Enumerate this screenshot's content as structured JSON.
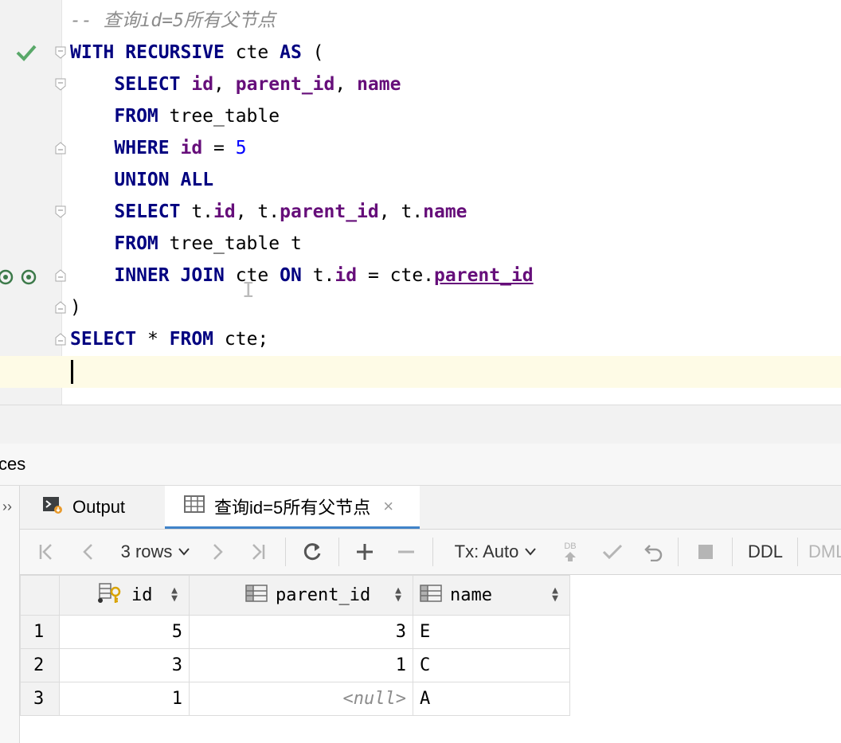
{
  "editor": {
    "lines": [
      {
        "comment": "-- 查询id=5所有父节点"
      },
      {
        "tokens": [
          [
            "kw",
            "WITH"
          ],
          [
            "t",
            " "
          ],
          [
            "kw",
            "RECURSIVE"
          ],
          [
            "t",
            " cte "
          ],
          [
            "kw",
            "AS"
          ],
          [
            "t",
            " ("
          ]
        ]
      },
      {
        "tokens": [
          [
            "t",
            "    "
          ],
          [
            "kw",
            "SELECT"
          ],
          [
            "t",
            " "
          ],
          [
            "col",
            "id"
          ],
          [
            "t",
            ", "
          ],
          [
            "col",
            "parent_id"
          ],
          [
            "t",
            ", "
          ],
          [
            "col",
            "name"
          ]
        ]
      },
      {
        "tokens": [
          [
            "t",
            "    "
          ],
          [
            "kw",
            "FROM"
          ],
          [
            "t",
            " tree_table"
          ]
        ]
      },
      {
        "tokens": [
          [
            "t",
            "    "
          ],
          [
            "kw",
            "WHERE"
          ],
          [
            "t",
            " "
          ],
          [
            "col",
            "id"
          ],
          [
            "t",
            " = "
          ],
          [
            "num",
            "5"
          ]
        ]
      },
      {
        "tokens": [
          [
            "t",
            "    "
          ],
          [
            "kw",
            "UNION"
          ],
          [
            "t",
            " "
          ],
          [
            "kw",
            "ALL"
          ]
        ]
      },
      {
        "tokens": [
          [
            "t",
            "    "
          ],
          [
            "kw",
            "SELECT"
          ],
          [
            "t",
            " t."
          ],
          [
            "col",
            "id"
          ],
          [
            "t",
            ", t."
          ],
          [
            "col",
            "parent_id"
          ],
          [
            "t",
            ", t."
          ],
          [
            "col",
            "name"
          ]
        ]
      },
      {
        "tokens": [
          [
            "t",
            "    "
          ],
          [
            "kw",
            "FROM"
          ],
          [
            "t",
            " tree_table t"
          ]
        ]
      },
      {
        "tokens": [
          [
            "t",
            "    "
          ],
          [
            "kw",
            "INNER"
          ],
          [
            "t",
            " "
          ],
          [
            "kw",
            "JOIN"
          ],
          [
            "t",
            " cte "
          ],
          [
            "kw",
            "ON"
          ],
          [
            "t",
            " t."
          ],
          [
            "col",
            "id"
          ],
          [
            "t",
            " = cte."
          ],
          [
            "colul",
            "parent_id"
          ]
        ]
      },
      {
        "tokens": [
          [
            "t",
            ")"
          ]
        ]
      },
      {
        "tokens": [
          [
            "kw",
            "SELECT"
          ],
          [
            "t",
            " * "
          ],
          [
            "kw",
            "FROM"
          ],
          [
            "t",
            " cte;"
          ]
        ]
      },
      {
        "tokens": []
      }
    ]
  },
  "panel": {
    "title": "ces"
  },
  "left_strip": {
    "chevron": "››"
  },
  "tabs": {
    "output_label": "Output",
    "result_label": "查询id=5所有父节点",
    "close_glyph": "×"
  },
  "toolbar": {
    "rows_label": "3 rows",
    "tx_label": "Tx: Auto",
    "ddl_label": "DDL",
    "dml_label": "DML",
    "db_label": "DB"
  },
  "grid": {
    "columns": [
      "id",
      "parent_id",
      "name"
    ],
    "rows": [
      {
        "num": "1",
        "id": "5",
        "parent_id": "3",
        "name": "E",
        "parent_null": false
      },
      {
        "num": "2",
        "id": "3",
        "parent_id": "1",
        "name": "C",
        "parent_null": false
      },
      {
        "num": "3",
        "id": "1",
        "parent_id": "<null>",
        "name": "A",
        "parent_null": true
      }
    ]
  },
  "colors": {
    "keyword": "#000080",
    "column": "#660e7a",
    "number": "#0000ff",
    "comment": "#8c8c8c",
    "current_line": "#fefbe6",
    "tab_accent": "#4083c9",
    "check": "#59a869"
  },
  "icons": [
    "check-icon",
    "fold-marker-icon",
    "sync-icon",
    "output-icon",
    "table-icon",
    "first-page-icon",
    "prev-page-icon",
    "next-page-icon",
    "last-page-icon",
    "refresh-icon",
    "add-row-icon",
    "remove-row-icon",
    "commit-icon",
    "rollback-icon",
    "stop-icon",
    "key-icon",
    "column-icon",
    "sort-icon"
  ]
}
